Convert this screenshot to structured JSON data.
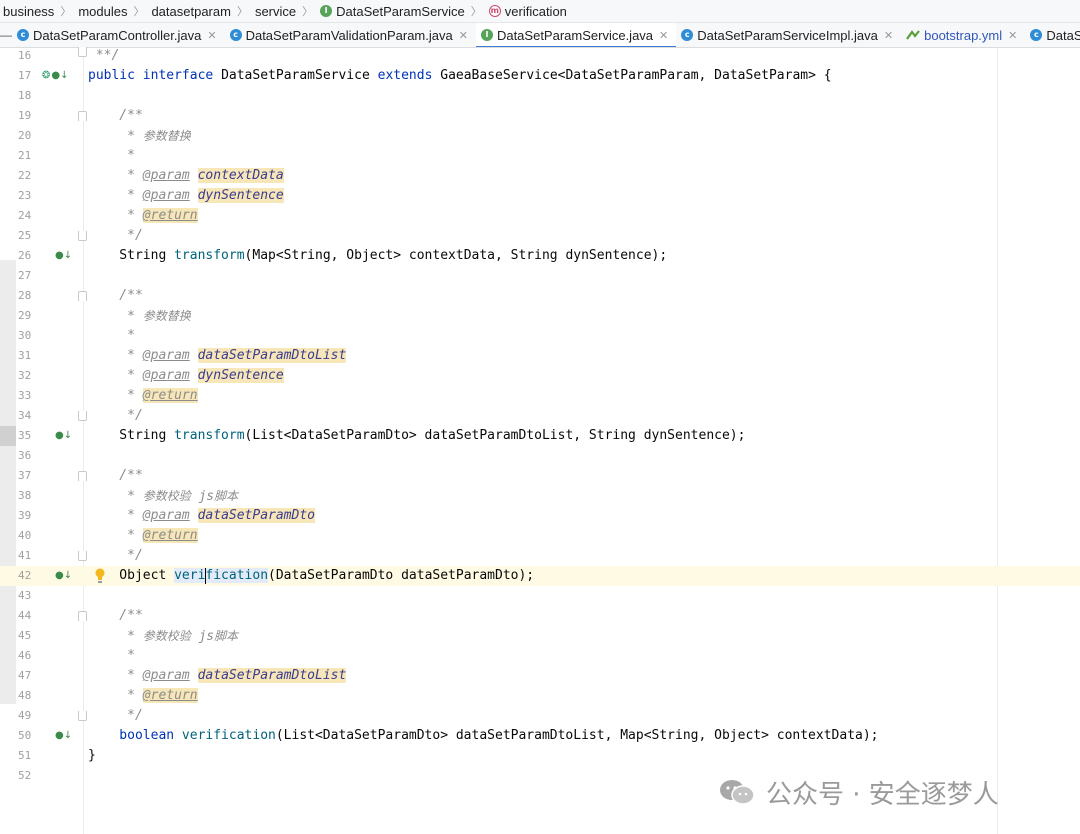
{
  "breadcrumb": [
    {
      "label": "business",
      "icon": ""
    },
    {
      "label": "modules",
      "icon": ""
    },
    {
      "label": "datasetparam",
      "icon": ""
    },
    {
      "label": "service",
      "icon": ""
    },
    {
      "label": "DataSetParamService",
      "icon": "interface-icon"
    },
    {
      "label": "verification",
      "icon": "method-icon"
    }
  ],
  "tabs": [
    {
      "label": "DataSetParamController.java",
      "icon": "class-icon",
      "active": false
    },
    {
      "label": "DataSetParamValidationParam.java",
      "icon": "class-icon",
      "active": false
    },
    {
      "label": "DataSetParamService.java",
      "icon": "interface-icon",
      "active": true
    },
    {
      "label": "DataSetParamServiceImpl.java",
      "icon": "class-icon",
      "active": false
    },
    {
      "label": "bootstrap.yml",
      "icon": "yaml-icon",
      "active": false
    },
    {
      "label": "DataSetPara",
      "icon": "class-icon",
      "active": false
    }
  ],
  "editor": {
    "current_line": 42,
    "lines": [
      {
        "n": "16",
        "gutter": "",
        "fold": ""
      },
      {
        "n": "17",
        "gutter": "implemented-icon",
        "fold": ""
      },
      {
        "n": "18"
      },
      {
        "n": "19",
        "fold": "start"
      },
      {
        "n": "20"
      },
      {
        "n": "21"
      },
      {
        "n": "22"
      },
      {
        "n": "23"
      },
      {
        "n": "24"
      },
      {
        "n": "25",
        "fold": "end"
      },
      {
        "n": "26",
        "gutter": "implemented-icon"
      },
      {
        "n": "27"
      },
      {
        "n": "28",
        "fold": "start"
      },
      {
        "n": "29"
      },
      {
        "n": "30"
      },
      {
        "n": "31"
      },
      {
        "n": "32"
      },
      {
        "n": "33"
      },
      {
        "n": "34",
        "fold": "end"
      },
      {
        "n": "35",
        "gutter": "implemented-icon"
      },
      {
        "n": "36"
      },
      {
        "n": "37",
        "fold": "start"
      },
      {
        "n": "38"
      },
      {
        "n": "39"
      },
      {
        "n": "40"
      },
      {
        "n": "41",
        "fold": "end"
      },
      {
        "n": "42",
        "gutter": "implemented-icon"
      },
      {
        "n": "43"
      },
      {
        "n": "44",
        "fold": "start"
      },
      {
        "n": "45"
      },
      {
        "n": "46"
      },
      {
        "n": "47"
      },
      {
        "n": "48"
      },
      {
        "n": "49",
        "fold": "end"
      },
      {
        "n": "50",
        "gutter": "implemented-icon"
      },
      {
        "n": "51"
      },
      {
        "n": "52"
      }
    ],
    "code": {
      "l16": " **/",
      "l17_kw1": "public",
      "l17_kw2": "interface",
      "l17_name": " DataSetParamService ",
      "l17_kw3": "extends",
      "l17_rest": " GaeaBaseService<DataSetParamParam, DataSetParam> {",
      "doc_open": "    /**",
      "doc_star": "     *",
      "doc_close": "     */",
      "doc_replace": "参数替换",
      "doc_verify": "参数校验  ",
      "doc_js": "js",
      "doc_script": "脚本",
      "tag_param": "@param",
      "tag_return": "@return",
      "p_contextData": "contextData",
      "p_dynSentence": "dynSentence",
      "p_dtoList": "dataSetParamDtoList",
      "p_dto": "dataSetParamDto",
      "l26_type": "    String ",
      "l26_fn": "transform",
      "l26_args": "(Map<String, Object> contextData, String dynSentence);",
      "l35_type": "    String ",
      "l35_fn": "transform",
      "l35_args": "(List<DataSetParamDto> dataSetParamDtoList, String dynSentence);",
      "l42_type": "    Object ",
      "l42_fn_a": "veri",
      "l42_fn_b": "fication",
      "l42_args": "(DataSetParamDto dataSetParamDto);",
      "l50_kw": "    boolean ",
      "l50_fn": "verification",
      "l50_args": "(List<DataSetParamDto> dataSetParamDtoList, Map<String, Object> contextData);",
      "l51": "}"
    }
  },
  "watermark": {
    "text": "公众号 · 安全逐梦人"
  },
  "colors": {
    "keyword": "#0033b3",
    "function": "#00627a",
    "comment": "#8c8c8c",
    "param_highlight": "#f7e7b8",
    "current_line": "#fffae3"
  }
}
